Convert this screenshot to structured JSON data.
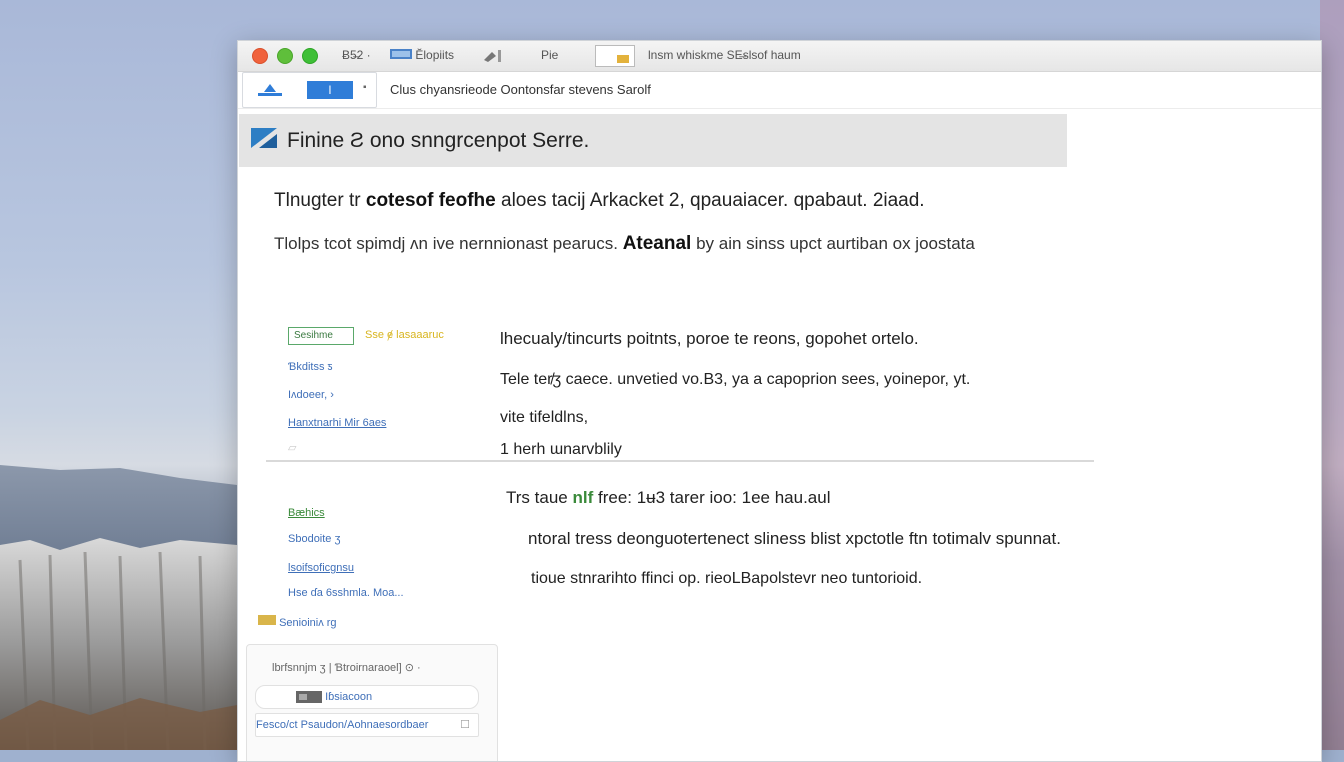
{
  "window": {
    "tabs": [
      "Ƀ5̶2 ·",
      "Ĕlopiits",
      "Pie",
      "lnsm whiskme SE̶slsof haum"
    ],
    "toolbar_button": "l",
    "toolbar_text": "Clus chyansrieode  Oontonsfar stevens Sarolf"
  },
  "banner": {
    "title": "Finine  Ƨ  ono snngrcenpot Serre."
  },
  "intro": {
    "line1_pre": "Tlnugter tr",
    "line1_bold": "cotesof feofhe",
    "line1_post": "aloes tacij Arkacket  2,  qpauaiacer.   qpabaut. 2iaad.",
    "line2_pre": "Tlolps tcot spimdj ʌn ive nernnionast pearucs.",
    "line2_bold": "Ateanal",
    "line2_post": "by ain sinss upct aurtiban ox joostata"
  },
  "section1": {
    "nav_box": "Sesihme",
    "nav_yellow": "Sse ɇ   lasaaaruc",
    "nav_items": [
      "Ɓkditss  ƽ",
      "Iʌdoeer,  ›",
      "Hanxtnarhi Mir 6aes"
    ],
    "heading": "lhecualy/tincurts  poitnts, poroe te reons, gopohet ortelo.",
    "line1": "Tele ter̸ʒ caece. unvetied vo.B3, ya a capoprion sees, yoinepor, yt.",
    "line2": "vite tifeldlns,",
    "line3": "1 herh ɯnarvblily"
  },
  "section2": {
    "nav_items": [
      "Bæhics",
      "Sbodoite  ʒ",
      "lsoifsoficgnsu",
      "Hse ɗa 6sshmla. Moa...",
      "Senioiniʌ rg"
    ],
    "heading_pre": "Trs taue",
    "heading_bold": "nlf",
    "heading_post": "free: 1ʉ3  tarer ioo: 1ee hau.aul",
    "line1": "ntoral tress deonguotertenect sliness blist xpctotle ftn totimalv spunnat.",
    "line2": "tioue stnrarihto ffinci op. rieoLBapolstevr neo tuntorioid."
  },
  "panel": {
    "title": "lbrfsnnjm ʒ | Ɓtroirnaraoel] ⊙  ·",
    "row1": "Iɓsiacoon",
    "row2": "Fesco/ct Psaudon/Aohnaesordbaer"
  },
  "colors": {
    "accent": "#2f7dd8",
    "banner_bg": "#e4e4e4",
    "nav_link": "#3f6fb8",
    "highlight_yellow": "#d8b520",
    "highlight_green": "#3a8a3a"
  }
}
